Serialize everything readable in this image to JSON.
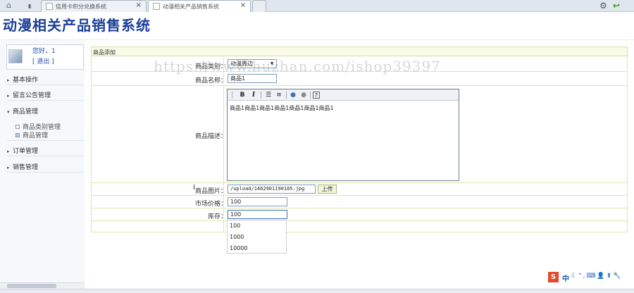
{
  "browser": {
    "tabs": [
      {
        "title": "信用卡积分兑换系统",
        "active": false
      },
      {
        "title": "动漫相关产品销售系统",
        "active": true
      }
    ],
    "close_glyph": "×",
    "icons": [
      "home-icon",
      "back-icon",
      "star-icon",
      "refresh-icon",
      "undo-icon"
    ]
  },
  "site": {
    "title": "动漫相关产品销售系统"
  },
  "sidebar": {
    "greeting": "您好，1",
    "logout": "[ 退出 ]",
    "menus": [
      {
        "label": "基本操作",
        "expanded": false
      },
      {
        "label": "留言公告管理",
        "expanded": false
      },
      {
        "label": "商品管理",
        "expanded": true,
        "items": [
          "商品类别管理",
          "商品管理"
        ]
      },
      {
        "label": "订单管理",
        "expanded": false
      },
      {
        "label": "销售管理",
        "expanded": false
      }
    ]
  },
  "form": {
    "section_title": "商品添加",
    "category": {
      "label": "商品类别：",
      "value": "动漫周边"
    },
    "name": {
      "label": "商品名称：",
      "value": "商品1"
    },
    "description": {
      "label": "商品描述：",
      "value": "商品1商品1商品1商品1商品1商品1商品1"
    },
    "image": {
      "label": "商品图片：",
      "value": "/upload/1462901190105.jpg",
      "upload_label": "上传"
    },
    "market_price": {
      "label": "市场价格：",
      "value": "100"
    },
    "stock": {
      "label": "库存：",
      "value": "100"
    },
    "autocomplete": [
      "100",
      "1000",
      "10000"
    ]
  },
  "editor_toolbar": {
    "bold": "B",
    "italic": "I",
    "help": "?"
  },
  "watermark": "https://www.huzhan.com/ishop39397",
  "ime": {
    "brand": "S",
    "mode": "中"
  },
  "colors": {
    "title": "#1c3f9a",
    "link": "#1f4ea8",
    "form_border": "#e0e6a9"
  }
}
